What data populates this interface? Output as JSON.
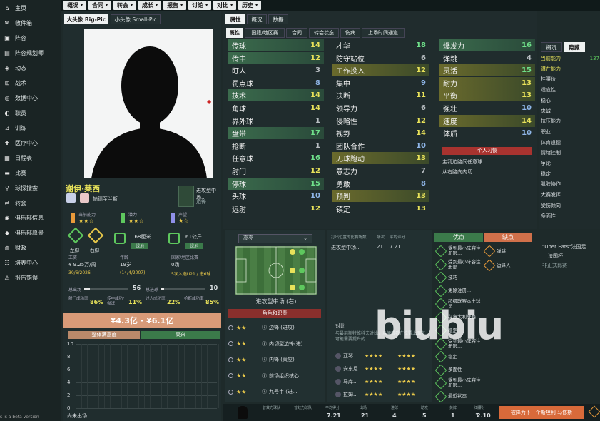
{
  "sidebar": {
    "items": [
      {
        "label": "主页",
        "icon": "home-icon",
        "glyph": "⌂"
      },
      {
        "label": "收件箱",
        "icon": "inbox-icon",
        "glyph": "✉"
      },
      {
        "label": "阵容",
        "icon": "squad-icon",
        "glyph": "▣"
      },
      {
        "label": "阵容规划师",
        "icon": "planner-icon",
        "glyph": "▤"
      },
      {
        "label": "动态",
        "icon": "news-icon",
        "glyph": "◈"
      },
      {
        "label": "战术",
        "icon": "tactics-icon",
        "glyph": "⊞"
      },
      {
        "label": "数据中心",
        "icon": "data-hub-icon",
        "glyph": "◎"
      },
      {
        "label": "职员",
        "icon": "staff-icon",
        "glyph": "◐"
      },
      {
        "label": "训练",
        "icon": "training-icon",
        "glyph": "⊿"
      },
      {
        "label": "医疗中心",
        "icon": "medical-icon",
        "glyph": "✚"
      },
      {
        "label": "日程表",
        "icon": "calendar-icon",
        "glyph": "▦"
      },
      {
        "label": "比赛",
        "icon": "match-icon",
        "glyph": "▬"
      },
      {
        "label": "球探搜索",
        "icon": "scouting-icon",
        "glyph": "⚲"
      },
      {
        "label": "转会",
        "icon": "transfer-icon",
        "glyph": "⇄"
      },
      {
        "label": "俱乐部信息",
        "icon": "club-info-icon",
        "glyph": "◉"
      },
      {
        "label": "俱乐部愿景",
        "icon": "club-vision-icon",
        "glyph": "◆"
      },
      {
        "label": "财政",
        "icon": "finance-icon",
        "glyph": "◍"
      },
      {
        "label": "培养中心",
        "icon": "development-icon",
        "glyph": "☷"
      },
      {
        "label": "报告错误",
        "icon": "bug-report-icon",
        "glyph": "⚠"
      }
    ],
    "footer": "s is a beta version"
  },
  "topnav": [
    "概况",
    "合同",
    "转会",
    "成长",
    "报告",
    "讨论",
    "对比",
    "历史"
  ],
  "left": {
    "tab_big": "大头像 Big-Pic",
    "tab_small": "小头像 Small-Pic",
    "name": "谢伊·莱西",
    "club": "帕德至兰斯",
    "position": "进攻型中场...",
    "position_sub": "边锋",
    "ratings": [
      {
        "label": "当前能力",
        "stars": "★★☆"
      },
      {
        "label": "潜力",
        "stars": "★★☆"
      },
      {
        "label": "声望",
        "stars": "★☆"
      }
    ],
    "feet": [
      {
        "label": "左脚",
        "val": "11"
      },
      {
        "label": "右脚",
        "val": "16"
      }
    ],
    "height": "168厘米",
    "height_tag": "绿地",
    "weight": "61公斤",
    "weight_tag": "绿地",
    "info": [
      {
        "k": "工资",
        "v": "¥ 9.25万/周",
        "s": "30/6/2026"
      },
      {
        "k": "年龄",
        "v": "19岁",
        "s": "(14/4/2007)"
      },
      {
        "k": "国家/地区比赛",
        "v": "0场",
        "s": "5次入选U21 / 进6球"
      }
    ],
    "bar1_label": "总出场",
    "bar1_val": "56",
    "bar2_label": "总进球",
    "bar2_val": "10",
    "stats": [
      {
        "k": "射门成功率",
        "v": "86%"
      },
      {
        "k": "传中成功/尝试",
        "v": "11%"
      },
      {
        "k": "过人成功率",
        "v": "22%"
      },
      {
        "k": "抢断成功率",
        "v": "85%"
      }
    ],
    "value": "¥4.3亿 - ¥6.1亿",
    "cond_label": "整体满意度",
    "cond_val": "高兴",
    "graph_ticks": [
      "10",
      "8",
      "6",
      "4",
      "2",
      "0"
    ],
    "graph_footer": "尚未出场"
  },
  "center_tabs": [
    "属性",
    "概况",
    "数据"
  ],
  "sub_tabs": [
    "属性",
    "国籍/地区赛",
    "合同",
    "转会状态",
    "伤病",
    "上场时间通道"
  ],
  "attrs_col1": [
    {
      "n": "传球",
      "v": "14",
      "c": "v-yellow",
      "hi": "g"
    },
    {
      "n": "传中",
      "v": "12",
      "c": "v-yellow",
      "hi": "g"
    },
    {
      "n": "盯人",
      "v": "3",
      "c": "v-grey",
      "hi": ""
    },
    {
      "n": "罚点球",
      "v": "8",
      "c": "v-blue",
      "hi": ""
    },
    {
      "n": "技术",
      "v": "14",
      "c": "v-yellow",
      "hi": "g"
    },
    {
      "n": "角球",
      "v": "14",
      "c": "v-yellow",
      "hi": ""
    },
    {
      "n": "界外球",
      "v": "1",
      "c": "v-grey",
      "hi": ""
    },
    {
      "n": "盘带",
      "v": "17",
      "c": "v-green",
      "hi": "g"
    },
    {
      "n": "抢断",
      "v": "1",
      "c": "v-grey",
      "hi": ""
    },
    {
      "n": "任意球",
      "v": "16",
      "c": "v-green",
      "hi": ""
    },
    {
      "n": "射门",
      "v": "12",
      "c": "v-yellow",
      "hi": ""
    },
    {
      "n": "停球",
      "v": "15",
      "c": "v-green",
      "hi": "g"
    },
    {
      "n": "头球",
      "v": "10",
      "c": "v-blue",
      "hi": ""
    },
    {
      "n": "远射",
      "v": "12",
      "c": "v-yellow",
      "hi": ""
    }
  ],
  "attrs_col2": [
    {
      "n": "才华",
      "v": "18",
      "c": "v-green",
      "hi": ""
    },
    {
      "n": "防守站位",
      "v": "6",
      "c": "v-grey",
      "hi": ""
    },
    {
      "n": "工作投入",
      "v": "12",
      "c": "v-yellow",
      "hi": "y"
    },
    {
      "n": "集中",
      "v": "9",
      "c": "v-blue",
      "hi": ""
    },
    {
      "n": "决断",
      "v": "11",
      "c": "v-yellow",
      "hi": ""
    },
    {
      "n": "领导力",
      "v": "6",
      "c": "v-grey",
      "hi": ""
    },
    {
      "n": "侵略性",
      "v": "12",
      "c": "v-yellow",
      "hi": ""
    },
    {
      "n": "视野",
      "v": "14",
      "c": "v-yellow",
      "hi": ""
    },
    {
      "n": "团队合作",
      "v": "10",
      "c": "v-blue",
      "hi": ""
    },
    {
      "n": "无球跑动",
      "v": "13",
      "c": "v-yellow",
      "hi": "y"
    },
    {
      "n": "意志力",
      "v": "7",
      "c": "v-grey",
      "hi": ""
    },
    {
      "n": "勇敢",
      "v": "8",
      "c": "v-blue",
      "hi": ""
    },
    {
      "n": "预判",
      "v": "13",
      "c": "v-yellow",
      "hi": "y"
    },
    {
      "n": "镇定",
      "v": "13",
      "c": "v-yellow",
      "hi": ""
    }
  ],
  "attrs_col3": [
    {
      "n": "爆发力",
      "v": "16",
      "c": "v-green",
      "hi": "g"
    },
    {
      "n": "弹跳",
      "v": "4",
      "c": "v-grey",
      "hi": ""
    },
    {
      "n": "灵活",
      "v": "15",
      "c": "v-green",
      "hi": "y"
    },
    {
      "n": "耐力",
      "v": "13",
      "c": "v-yellow",
      "hi": "y"
    },
    {
      "n": "平衡",
      "v": "13",
      "c": "v-yellow",
      "hi": "y"
    },
    {
      "n": "强壮",
      "v": "10",
      "c": "v-blue",
      "hi": ""
    },
    {
      "n": "速度",
      "v": "14",
      "c": "v-yellow",
      "hi": "y"
    },
    {
      "n": "体质",
      "v": "10",
      "c": "v-blue",
      "hi": ""
    }
  ],
  "habits_title": "个人习惯",
  "habits": [
    "主罚边路间任意球",
    "从右路向内切"
  ],
  "right_tabs": [
    "概况",
    "隐藏"
  ],
  "hidden_attrs": [
    {
      "n": "当前能力",
      "v": "137"
    },
    {
      "n": "潜在能力",
      "v": ""
    },
    {
      "n": "挂腰价",
      "v": ""
    },
    {
      "n": "适应性",
      "v": ""
    },
    {
      "n": "稳心",
      "v": ""
    },
    {
      "n": "忠诚",
      "v": ""
    },
    {
      "n": "抗压能力",
      "v": ""
    },
    {
      "n": "职业",
      "v": ""
    },
    {
      "n": "体育道德",
      "v": ""
    },
    {
      "n": "情绪控制",
      "v": ""
    },
    {
      "n": "争论",
      "v": ""
    },
    {
      "n": "稳定",
      "v": ""
    },
    {
      "n": "肌肤协作",
      "v": ""
    },
    {
      "n": "大赛发挥",
      "v": ""
    },
    {
      "n": "受伤倾向",
      "v": ""
    },
    {
      "n": "多面性",
      "v": ""
    }
  ],
  "role_select": "高亮",
  "pitch_label": "进攻型中场 (右)",
  "role_title": "角色和职责",
  "roles": [
    {
      "stars": "★★",
      "label": "边锋 (进攻)"
    },
    {
      "stars": "★★",
      "label": "内切型边锋(进)"
    },
    {
      "stars": "★★",
      "label": "内锋 (策应)"
    },
    {
      "stars": "★★",
      "label": "前场组织核心"
    },
    {
      "stars": "★★",
      "label": "九号半 (进..."
    }
  ],
  "match_header": [
    "打出位置的比赛场数",
    "场次",
    "平均评分"
  ],
  "match_row": {
    "pos": "进攻型中场...",
    "games": "21",
    "rating": "7.21"
  },
  "compare_title": "对比",
  "compare_note": "与最前斯特维科夫对比，以便看看在位置上面有可能需要提升的",
  "compare_rows": [
    {
      "name": "亚琴...",
      "s1": "★★★★",
      "s2": "★★★★"
    },
    {
      "name": "安东尼",
      "s1": "★★★★",
      "s2": "★★★★"
    },
    {
      "name": "马库...",
      "s1": "★★★★",
      "s2": "★★★★"
    },
    {
      "name": "拉姆...",
      "s1": "★★★★",
      "s2": "★★★★"
    }
  ],
  "strengths_title": "优点",
  "weakness_title": "缺点",
  "strengths": [
    "受到最小阵容注册限...",
    "受到最小阵容注册限...",
    "技巧",
    "免除注册...",
    "超级联赛本土球员",
    "在意大利联赛...",
    "稳定",
    "受到最小阵容注册限...",
    "稳定",
    "多面性",
    "受到最小阵容注册限...",
    "最近状态"
  ],
  "weaknesses": [
    "弹跳",
    "边锋人"
  ],
  "sponsor": "\"Uber Eats\"法国足...",
  "sponsor_sub": "法国杯",
  "sponsor_sub2": "非正式比赛",
  "bottom": {
    "items": [
      {
        "k": "曾效力球队",
        "v": ""
      },
      {
        "k": "曾效力球队",
        "v": ""
      },
      {
        "k": "平均得分",
        "v": "7.21"
      },
      {
        "k": "出场",
        "v": "21"
      },
      {
        "k": "进球",
        "v": "4"
      },
      {
        "k": "助攻",
        "v": "5"
      },
      {
        "k": "黄牌",
        "v": "1"
      },
      {
        "k": "红牌",
        "v": "1"
      },
      {
        "k": "评分",
        "v": "2.10"
      }
    ],
    "action": "被降为下一个斯坦利·马修斯"
  },
  "watermark": "biubiu"
}
